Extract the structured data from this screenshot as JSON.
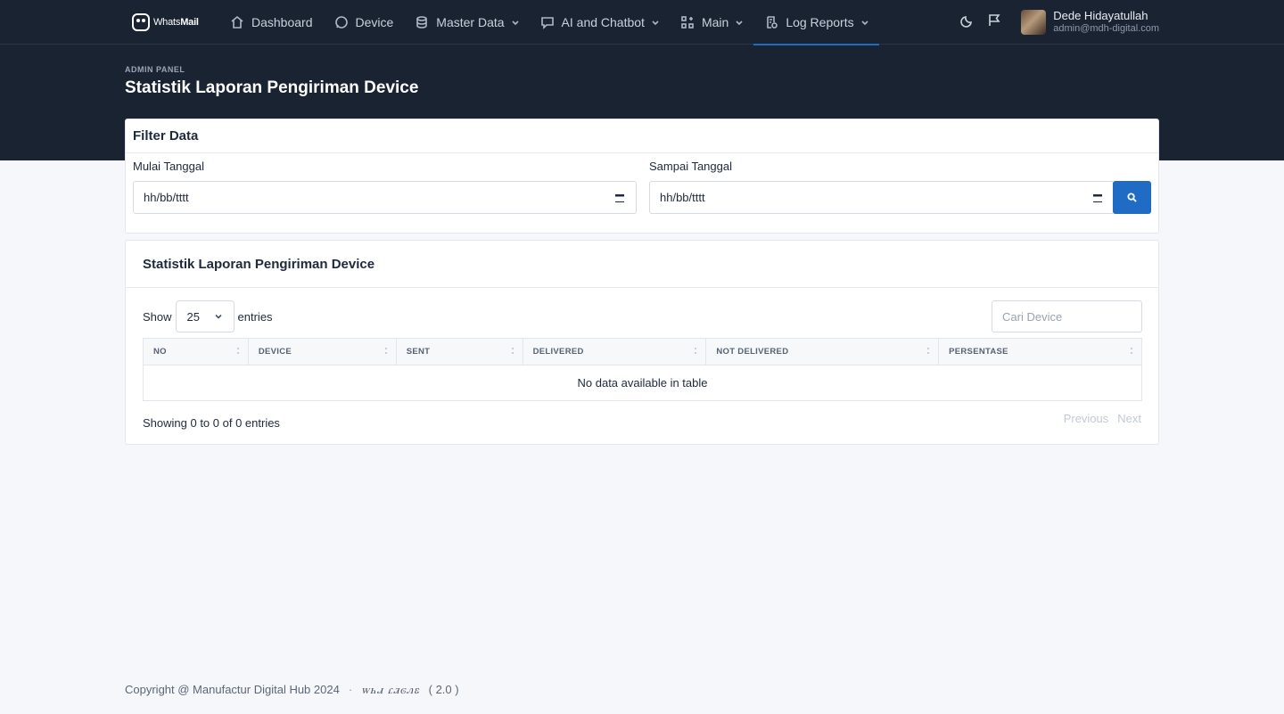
{
  "brand": {
    "name_prefix": "Whats",
    "name_bold": "Mail"
  },
  "nav": {
    "items": [
      {
        "label": "Dashboard"
      },
      {
        "label": "Device"
      },
      {
        "label": "Master Data"
      },
      {
        "label": "AI and Chatbot"
      },
      {
        "label": "Main"
      },
      {
        "label": "Log Reports"
      }
    ]
  },
  "user": {
    "name": "Dede Hidayatullah",
    "email": "admin@mdh-digital.com"
  },
  "page": {
    "pretitle": "ADMIN PANEL",
    "title": "Statistik Laporan Pengiriman Device"
  },
  "filter": {
    "title": "Filter Data",
    "start_label": "Mulai Tanggal",
    "end_label": "Sampai Tanggal",
    "start_value": "hh/bb/tttt",
    "end_value": "hh/bb/tttt"
  },
  "table": {
    "title": "Statistik Laporan Pengiriman Device",
    "show_label": "Show",
    "entries_label": "entries",
    "page_size": "25",
    "search_placeholder": "Cari Device",
    "columns": [
      "NO",
      "DEVICE",
      "SENT",
      "DELIVERED",
      "NOT DELIVERED",
      "PERSENTASE"
    ],
    "empty": "No data available in table",
    "info": "Showing 0 to 0 of 0 entries",
    "previous": "Previous",
    "next": "Next"
  },
  "footer": {
    "copyright": "Copyright @ Manufactur Digital Hub 2024",
    "separator": "·",
    "stylized": "ꮃꮒꮧ ꮭꮨꮆꮑꮛ",
    "version": "( 2.0 )"
  },
  "colors": {
    "header_bg": "#1a2332",
    "primary": "#206bc4",
    "page_bg": "#f5f7fb"
  },
  "icons": {
    "nav": [
      "home-icon",
      "whatsapp-icon",
      "database-icon",
      "chat-icon",
      "apps-icon",
      "report-icon"
    ],
    "right": [
      "moon-icon",
      "flag-icon"
    ]
  }
}
